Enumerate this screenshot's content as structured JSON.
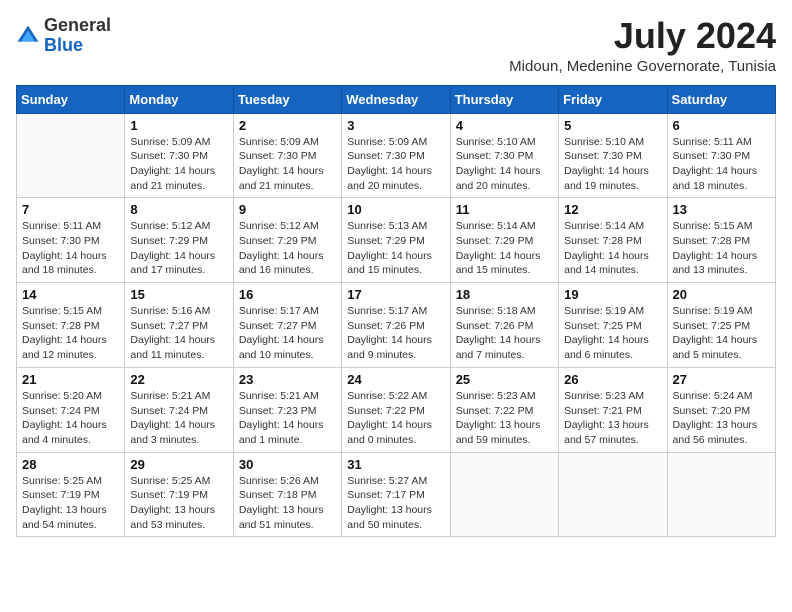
{
  "header": {
    "logo_line1": "General",
    "logo_line2": "Blue",
    "month_year": "July 2024",
    "location": "Midoun, Medenine Governorate, Tunisia"
  },
  "days_of_week": [
    "Sunday",
    "Monday",
    "Tuesday",
    "Wednesday",
    "Thursday",
    "Friday",
    "Saturday"
  ],
  "weeks": [
    [
      {
        "day": "",
        "info": ""
      },
      {
        "day": "1",
        "info": "Sunrise: 5:09 AM\nSunset: 7:30 PM\nDaylight: 14 hours\nand 21 minutes."
      },
      {
        "day": "2",
        "info": "Sunrise: 5:09 AM\nSunset: 7:30 PM\nDaylight: 14 hours\nand 21 minutes."
      },
      {
        "day": "3",
        "info": "Sunrise: 5:09 AM\nSunset: 7:30 PM\nDaylight: 14 hours\nand 20 minutes."
      },
      {
        "day": "4",
        "info": "Sunrise: 5:10 AM\nSunset: 7:30 PM\nDaylight: 14 hours\nand 20 minutes."
      },
      {
        "day": "5",
        "info": "Sunrise: 5:10 AM\nSunset: 7:30 PM\nDaylight: 14 hours\nand 19 minutes."
      },
      {
        "day": "6",
        "info": "Sunrise: 5:11 AM\nSunset: 7:30 PM\nDaylight: 14 hours\nand 18 minutes."
      }
    ],
    [
      {
        "day": "7",
        "info": "Sunrise: 5:11 AM\nSunset: 7:30 PM\nDaylight: 14 hours\nand 18 minutes."
      },
      {
        "day": "8",
        "info": "Sunrise: 5:12 AM\nSunset: 7:29 PM\nDaylight: 14 hours\nand 17 minutes."
      },
      {
        "day": "9",
        "info": "Sunrise: 5:12 AM\nSunset: 7:29 PM\nDaylight: 14 hours\nand 16 minutes."
      },
      {
        "day": "10",
        "info": "Sunrise: 5:13 AM\nSunset: 7:29 PM\nDaylight: 14 hours\nand 15 minutes."
      },
      {
        "day": "11",
        "info": "Sunrise: 5:14 AM\nSunset: 7:29 PM\nDaylight: 14 hours\nand 15 minutes."
      },
      {
        "day": "12",
        "info": "Sunrise: 5:14 AM\nSunset: 7:28 PM\nDaylight: 14 hours\nand 14 minutes."
      },
      {
        "day": "13",
        "info": "Sunrise: 5:15 AM\nSunset: 7:28 PM\nDaylight: 14 hours\nand 13 minutes."
      }
    ],
    [
      {
        "day": "14",
        "info": "Sunrise: 5:15 AM\nSunset: 7:28 PM\nDaylight: 14 hours\nand 12 minutes."
      },
      {
        "day": "15",
        "info": "Sunrise: 5:16 AM\nSunset: 7:27 PM\nDaylight: 14 hours\nand 11 minutes."
      },
      {
        "day": "16",
        "info": "Sunrise: 5:17 AM\nSunset: 7:27 PM\nDaylight: 14 hours\nand 10 minutes."
      },
      {
        "day": "17",
        "info": "Sunrise: 5:17 AM\nSunset: 7:26 PM\nDaylight: 14 hours\nand 9 minutes."
      },
      {
        "day": "18",
        "info": "Sunrise: 5:18 AM\nSunset: 7:26 PM\nDaylight: 14 hours\nand 7 minutes."
      },
      {
        "day": "19",
        "info": "Sunrise: 5:19 AM\nSunset: 7:25 PM\nDaylight: 14 hours\nand 6 minutes."
      },
      {
        "day": "20",
        "info": "Sunrise: 5:19 AM\nSunset: 7:25 PM\nDaylight: 14 hours\nand 5 minutes."
      }
    ],
    [
      {
        "day": "21",
        "info": "Sunrise: 5:20 AM\nSunset: 7:24 PM\nDaylight: 14 hours\nand 4 minutes."
      },
      {
        "day": "22",
        "info": "Sunrise: 5:21 AM\nSunset: 7:24 PM\nDaylight: 14 hours\nand 3 minutes."
      },
      {
        "day": "23",
        "info": "Sunrise: 5:21 AM\nSunset: 7:23 PM\nDaylight: 14 hours\nand 1 minute."
      },
      {
        "day": "24",
        "info": "Sunrise: 5:22 AM\nSunset: 7:22 PM\nDaylight: 14 hours\nand 0 minutes."
      },
      {
        "day": "25",
        "info": "Sunrise: 5:23 AM\nSunset: 7:22 PM\nDaylight: 13 hours\nand 59 minutes."
      },
      {
        "day": "26",
        "info": "Sunrise: 5:23 AM\nSunset: 7:21 PM\nDaylight: 13 hours\nand 57 minutes."
      },
      {
        "day": "27",
        "info": "Sunrise: 5:24 AM\nSunset: 7:20 PM\nDaylight: 13 hours\nand 56 minutes."
      }
    ],
    [
      {
        "day": "28",
        "info": "Sunrise: 5:25 AM\nSunset: 7:19 PM\nDaylight: 13 hours\nand 54 minutes."
      },
      {
        "day": "29",
        "info": "Sunrise: 5:25 AM\nSunset: 7:19 PM\nDaylight: 13 hours\nand 53 minutes."
      },
      {
        "day": "30",
        "info": "Sunrise: 5:26 AM\nSunset: 7:18 PM\nDaylight: 13 hours\nand 51 minutes."
      },
      {
        "day": "31",
        "info": "Sunrise: 5:27 AM\nSunset: 7:17 PM\nDaylight: 13 hours\nand 50 minutes."
      },
      {
        "day": "",
        "info": ""
      },
      {
        "day": "",
        "info": ""
      },
      {
        "day": "",
        "info": ""
      }
    ]
  ]
}
